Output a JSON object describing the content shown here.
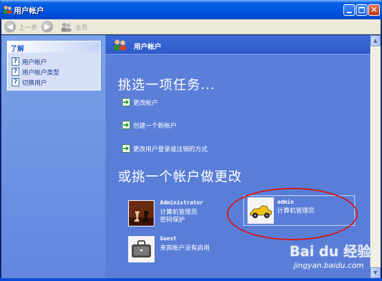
{
  "window": {
    "title": "用户帐户"
  },
  "toolbar": {
    "back_label": "上一步",
    "home_label": "主页"
  },
  "sidebar": {
    "learn_title": "了解",
    "items": [
      {
        "label": "用户帐户"
      },
      {
        "label": "用户帐户类型"
      },
      {
        "label": "切换用户"
      }
    ]
  },
  "main": {
    "header_title": "用户帐户",
    "pick_task": "挑选一项任务...",
    "tasks": [
      {
        "label": "更改帐户"
      },
      {
        "label": "创建一个新帐户"
      },
      {
        "label": "更改用户登录或注销的方式"
      }
    ],
    "pick_account": "或挑一个帐户做更改",
    "accounts": [
      {
        "name": "Administrator",
        "type": "计算机管理员",
        "status": "密码保护",
        "picture": "chess-icon"
      },
      {
        "name": "admin",
        "type": "计算机管理员",
        "picture": "race-car-icon"
      },
      {
        "name": "Guest",
        "type": "来宾帐户没有启用",
        "picture": "briefcase-icon"
      }
    ]
  },
  "watermark": {
    "logo": "Bai du 经验",
    "url": "jingyan.baidu.com"
  },
  "colors": {
    "title_bar": "#0054e3",
    "sidebar": "#7ba2e7",
    "main": "#5a7ed8",
    "highlight_ellipse": "#d51818"
  }
}
